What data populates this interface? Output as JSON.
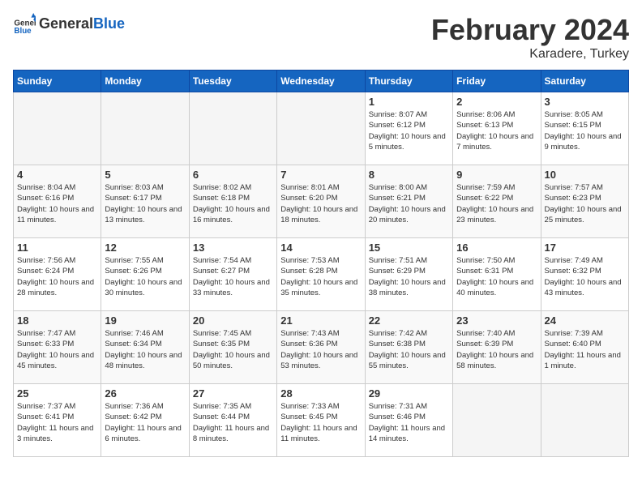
{
  "header": {
    "logo_general": "General",
    "logo_blue": "Blue",
    "month_year": "February 2024",
    "location": "Karadere, Turkey"
  },
  "weekdays": [
    "Sunday",
    "Monday",
    "Tuesday",
    "Wednesday",
    "Thursday",
    "Friday",
    "Saturday"
  ],
  "weeks": [
    [
      {
        "day": "",
        "empty": true
      },
      {
        "day": "",
        "empty": true
      },
      {
        "day": "",
        "empty": true
      },
      {
        "day": "",
        "empty": true
      },
      {
        "day": "1",
        "sunrise": "8:07 AM",
        "sunset": "6:12 PM",
        "daylight": "10 hours and 5 minutes."
      },
      {
        "day": "2",
        "sunrise": "8:06 AM",
        "sunset": "6:13 PM",
        "daylight": "10 hours and 7 minutes."
      },
      {
        "day": "3",
        "sunrise": "8:05 AM",
        "sunset": "6:15 PM",
        "daylight": "10 hours and 9 minutes."
      }
    ],
    [
      {
        "day": "4",
        "sunrise": "8:04 AM",
        "sunset": "6:16 PM",
        "daylight": "10 hours and 11 minutes."
      },
      {
        "day": "5",
        "sunrise": "8:03 AM",
        "sunset": "6:17 PM",
        "daylight": "10 hours and 13 minutes."
      },
      {
        "day": "6",
        "sunrise": "8:02 AM",
        "sunset": "6:18 PM",
        "daylight": "10 hours and 16 minutes."
      },
      {
        "day": "7",
        "sunrise": "8:01 AM",
        "sunset": "6:20 PM",
        "daylight": "10 hours and 18 minutes."
      },
      {
        "day": "8",
        "sunrise": "8:00 AM",
        "sunset": "6:21 PM",
        "daylight": "10 hours and 20 minutes."
      },
      {
        "day": "9",
        "sunrise": "7:59 AM",
        "sunset": "6:22 PM",
        "daylight": "10 hours and 23 minutes."
      },
      {
        "day": "10",
        "sunrise": "7:57 AM",
        "sunset": "6:23 PM",
        "daylight": "10 hours and 25 minutes."
      }
    ],
    [
      {
        "day": "11",
        "sunrise": "7:56 AM",
        "sunset": "6:24 PM",
        "daylight": "10 hours and 28 minutes."
      },
      {
        "day": "12",
        "sunrise": "7:55 AM",
        "sunset": "6:26 PM",
        "daylight": "10 hours and 30 minutes."
      },
      {
        "day": "13",
        "sunrise": "7:54 AM",
        "sunset": "6:27 PM",
        "daylight": "10 hours and 33 minutes."
      },
      {
        "day": "14",
        "sunrise": "7:53 AM",
        "sunset": "6:28 PM",
        "daylight": "10 hours and 35 minutes."
      },
      {
        "day": "15",
        "sunrise": "7:51 AM",
        "sunset": "6:29 PM",
        "daylight": "10 hours and 38 minutes."
      },
      {
        "day": "16",
        "sunrise": "7:50 AM",
        "sunset": "6:31 PM",
        "daylight": "10 hours and 40 minutes."
      },
      {
        "day": "17",
        "sunrise": "7:49 AM",
        "sunset": "6:32 PM",
        "daylight": "10 hours and 43 minutes."
      }
    ],
    [
      {
        "day": "18",
        "sunrise": "7:47 AM",
        "sunset": "6:33 PM",
        "daylight": "10 hours and 45 minutes."
      },
      {
        "day": "19",
        "sunrise": "7:46 AM",
        "sunset": "6:34 PM",
        "daylight": "10 hours and 48 minutes."
      },
      {
        "day": "20",
        "sunrise": "7:45 AM",
        "sunset": "6:35 PM",
        "daylight": "10 hours and 50 minutes."
      },
      {
        "day": "21",
        "sunrise": "7:43 AM",
        "sunset": "6:36 PM",
        "daylight": "10 hours and 53 minutes."
      },
      {
        "day": "22",
        "sunrise": "7:42 AM",
        "sunset": "6:38 PM",
        "daylight": "10 hours and 55 minutes."
      },
      {
        "day": "23",
        "sunrise": "7:40 AM",
        "sunset": "6:39 PM",
        "daylight": "10 hours and 58 minutes."
      },
      {
        "day": "24",
        "sunrise": "7:39 AM",
        "sunset": "6:40 PM",
        "daylight": "11 hours and 1 minute."
      }
    ],
    [
      {
        "day": "25",
        "sunrise": "7:37 AM",
        "sunset": "6:41 PM",
        "daylight": "11 hours and 3 minutes."
      },
      {
        "day": "26",
        "sunrise": "7:36 AM",
        "sunset": "6:42 PM",
        "daylight": "11 hours and 6 minutes."
      },
      {
        "day": "27",
        "sunrise": "7:35 AM",
        "sunset": "6:44 PM",
        "daylight": "11 hours and 8 minutes."
      },
      {
        "day": "28",
        "sunrise": "7:33 AM",
        "sunset": "6:45 PM",
        "daylight": "11 hours and 11 minutes."
      },
      {
        "day": "29",
        "sunrise": "7:31 AM",
        "sunset": "6:46 PM",
        "daylight": "11 hours and 14 minutes."
      },
      {
        "day": "",
        "empty": true
      },
      {
        "day": "",
        "empty": true
      }
    ]
  ]
}
